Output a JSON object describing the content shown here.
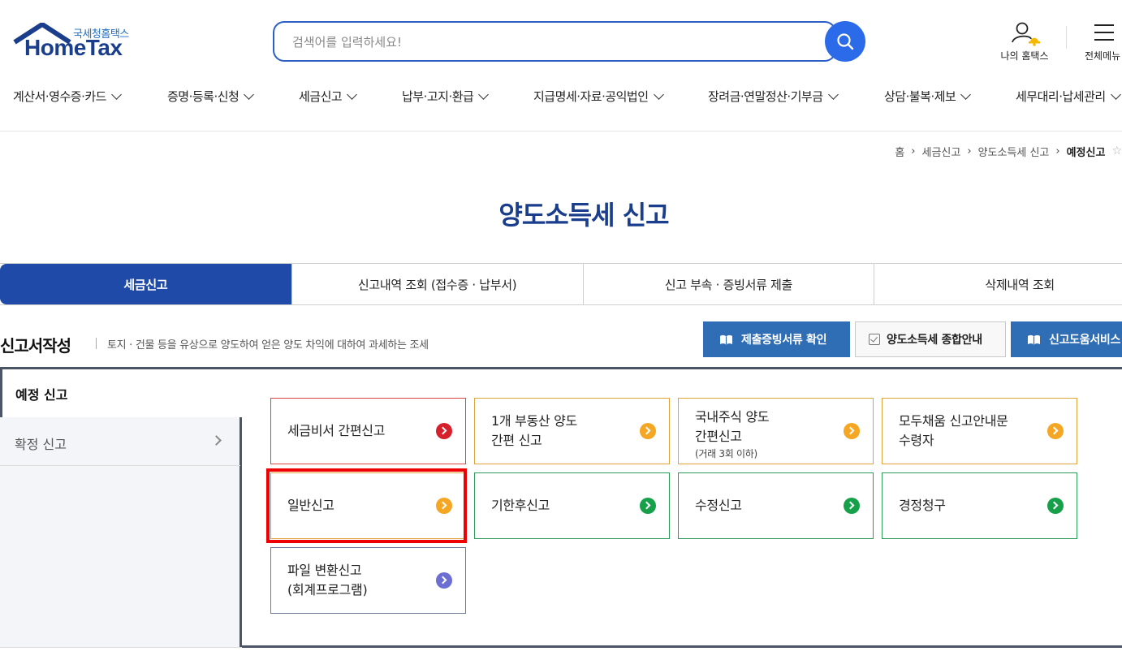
{
  "header": {
    "logo_small": "국세청홈택스",
    "logo_big": "HomeTax",
    "search_placeholder": "검색어를 입력하세요!",
    "my_hometax_label": "나의 홈택스",
    "all_menu_label": "전체메뉴"
  },
  "gnb": [
    {
      "label": "계산서·영수증·카드"
    },
    {
      "label": "증명·등록·신청"
    },
    {
      "label": "세금신고"
    },
    {
      "label": "납부·고지·환급"
    },
    {
      "label": "지급명세·자료·공익법인"
    },
    {
      "label": "장려금·연말정산·기부금"
    },
    {
      "label": "상담·불복·제보"
    },
    {
      "label": "세무대리·납세관리"
    }
  ],
  "breadcrumb": [
    "홈",
    "세금신고",
    "양도소득세 신고",
    "예정신고"
  ],
  "page_title": "양도소득세 신고",
  "tabs": [
    {
      "label": "세금신고"
    },
    {
      "label": "신고내역 조회 (접수증 · 납부서)"
    },
    {
      "label": "신고 부속 · 증빙서류 제출"
    },
    {
      "label": "삭제내역 조회"
    }
  ],
  "section": {
    "title": "신고서작성",
    "description": "토지 · 건물 등을 유상으로 양도하여 얻은 양도 차익에 대하여 과세하는 조세"
  },
  "action_buttons": {
    "submit_docs": "제출증빙서류 확인",
    "guide": "양도소득세 종합안내",
    "help_service": "신고도움서비스"
  },
  "left_menu": [
    {
      "label": "예정 신고"
    },
    {
      "label": "확정 신고"
    }
  ],
  "cards": [
    {
      "label": "세금비서 간편신고",
      "sub": "",
      "color": "#d6202b"
    },
    {
      "label": "1개 부동산 양도\n간편 신고",
      "sub": "",
      "color": "#f5a623"
    },
    {
      "label": "국내주식 양도\n간편신고",
      "sub": "(거래 3회 이하)",
      "color": "#f5a623"
    },
    {
      "label": "모두채움 신고안내문\n수령자",
      "sub": "",
      "color": "#f5a623"
    },
    {
      "label": "일반신고",
      "sub": "",
      "color": "#f5a623"
    },
    {
      "label": "기한후신고",
      "sub": "",
      "color": "#17a04a"
    },
    {
      "label": "수정신고",
      "sub": "",
      "color": "#17a04a"
    },
    {
      "label": "경정청구",
      "sub": "",
      "color": "#17a04a"
    },
    {
      "label": "파일 변환신고\n(회계프로그램)",
      "sub": "",
      "color": "#6c6fd1"
    }
  ],
  "colors": {
    "brand_blue": "#1a3e8c",
    "tab_active": "#1f4aa8",
    "button_blue": "#2f6db4",
    "highlight": "#ee0000"
  }
}
